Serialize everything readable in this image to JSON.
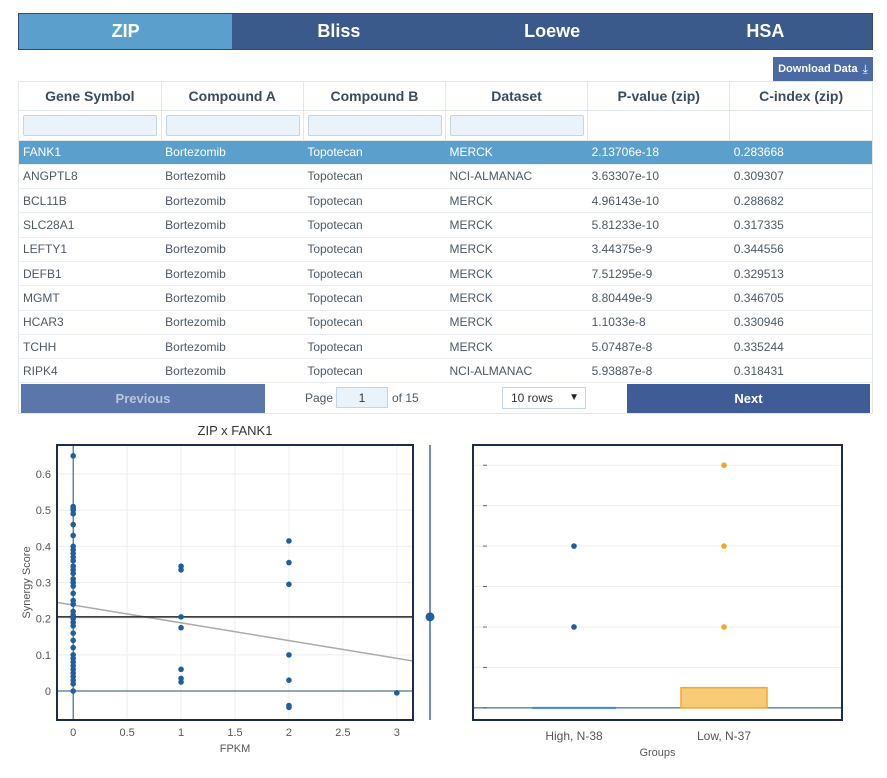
{
  "tabs": [
    {
      "label": "ZIP",
      "active": true
    },
    {
      "label": "Bliss",
      "active": false
    },
    {
      "label": "Loewe",
      "active": false
    },
    {
      "label": "HSA",
      "active": false
    }
  ],
  "download_label": "Download Data",
  "table": {
    "columns": [
      "Gene Symbol",
      "Compound A",
      "Compound B",
      "Dataset",
      "P-value (zip)",
      "C-index (zip)"
    ],
    "rows": [
      [
        "FANK1",
        "Bortezomib",
        "Topotecan",
        "MERCK",
        "2.13706e-18",
        "0.283668"
      ],
      [
        "ANGPTL8",
        "Bortezomib",
        "Topotecan",
        "NCI-ALMANAC",
        "3.63307e-10",
        "0.309307"
      ],
      [
        "BCL11B",
        "Bortezomib",
        "Topotecan",
        "MERCK",
        "4.96143e-10",
        "0.288682"
      ],
      [
        "SLC28A1",
        "Bortezomib",
        "Topotecan",
        "MERCK",
        "5.81233e-10",
        "0.317335"
      ],
      [
        "LEFTY1",
        "Bortezomib",
        "Topotecan",
        "MERCK",
        "3.44375e-9",
        "0.344556"
      ],
      [
        "DEFB1",
        "Bortezomib",
        "Topotecan",
        "MERCK",
        "7.51295e-9",
        "0.329513"
      ],
      [
        "MGMT",
        "Bortezomib",
        "Topotecan",
        "MERCK",
        "8.80449e-9",
        "0.346705"
      ],
      [
        "HCAR3",
        "Bortezomib",
        "Topotecan",
        "MERCK",
        "1.1033e-8",
        "0.330946"
      ],
      [
        "TCHH",
        "Bortezomib",
        "Topotecan",
        "MERCK",
        "5.07487e-8",
        "0.335244"
      ],
      [
        "RIPK4",
        "Bortezomib",
        "Topotecan",
        "NCI-ALMANAC",
        "5.93887e-8",
        "0.318431"
      ]
    ],
    "selected_row": 0
  },
  "pagination": {
    "prev_label": "Previous",
    "next_label": "Next",
    "page_label": "Page",
    "page_value": "1",
    "of_label": "of 15",
    "rows_option": "10 rows"
  },
  "colors": {
    "accent": "#5ba0cd",
    "tab_bar": "#3a5a8c",
    "point_blue": "#1f5fa0",
    "point_orange": "#f5a623",
    "box_fill": "#f7cb78"
  },
  "chart_data": [
    {
      "type": "scatter",
      "title": "ZIP x FANK1",
      "xlabel": "FPKM",
      "ylabel": "Synergy Score",
      "xlim": [
        -0.15,
        3.15
      ],
      "ylim": [
        -0.08,
        0.68
      ],
      "xticks": [
        0,
        0.5,
        1,
        1.5,
        2,
        2.5,
        3
      ],
      "xtick_labels": [
        "0",
        "0.5",
        "1",
        "1.5",
        "2",
        "2.5",
        "3"
      ],
      "yticks": [
        0,
        0.1,
        0.2,
        0.3,
        0.4,
        0.5,
        0.6
      ],
      "ytick_labels": [
        "0",
        "0.1",
        "0.2",
        "0.3",
        "0.4",
        "0.5",
        "0.6"
      ],
      "points": [
        [
          0,
          0.65
        ],
        [
          0,
          0.51
        ],
        [
          0,
          0.505
        ],
        [
          0,
          0.5
        ],
        [
          0,
          0.49
        ],
        [
          0,
          0.46
        ],
        [
          0,
          0.43
        ],
        [
          0,
          0.4
        ],
        [
          0,
          0.39
        ],
        [
          0,
          0.38
        ],
        [
          0,
          0.37
        ],
        [
          0,
          0.36
        ],
        [
          0,
          0.345
        ],
        [
          0,
          0.335
        ],
        [
          0,
          0.325
        ],
        [
          0,
          0.31
        ],
        [
          0,
          0.3
        ],
        [
          0,
          0.29
        ],
        [
          0,
          0.27
        ],
        [
          0,
          0.25
        ],
        [
          0,
          0.24
        ],
        [
          0,
          0.22
        ],
        [
          0,
          0.21
        ],
        [
          0,
          0.2
        ],
        [
          0,
          0.19
        ],
        [
          0,
          0.18
        ],
        [
          0,
          0.16
        ],
        [
          0,
          0.14
        ],
        [
          0,
          0.12
        ],
        [
          0,
          0.1
        ],
        [
          0,
          0.09
        ],
        [
          0,
          0.08
        ],
        [
          0,
          0.07
        ],
        [
          0,
          0.06
        ],
        [
          0,
          0.05
        ],
        [
          0,
          0.04
        ],
        [
          0,
          0.03
        ],
        [
          0,
          0.02
        ],
        [
          0,
          0.0
        ],
        [
          1,
          0.345
        ],
        [
          1,
          0.335
        ],
        [
          1,
          0.205
        ],
        [
          1,
          0.175
        ],
        [
          1,
          0.06
        ],
        [
          1,
          0.035
        ],
        [
          1,
          0.025
        ],
        [
          2,
          0.415
        ],
        [
          2,
          0.355
        ],
        [
          2,
          0.295
        ],
        [
          2,
          0.1
        ],
        [
          2,
          0.03
        ],
        [
          2,
          -0.04
        ],
        [
          2,
          -0.045
        ],
        [
          3,
          -0.005
        ]
      ],
      "trend_line": [
        [
          -0.15,
          0.245
        ],
        [
          3.15,
          0.083
        ]
      ],
      "hline": 0.205
    },
    {
      "type": "box",
      "xlabel": "Groups",
      "categories": [
        "High, N-38",
        "Low, N-37"
      ],
      "series": [
        {
          "outliers": [
            0.2,
            0.4
          ]
        },
        {
          "outliers": [
            0.2,
            0.4,
            0.6
          ],
          "box": [
            0,
            0.05
          ]
        }
      ],
      "ylim": [
        -0.03,
        0.65
      ],
      "yticks": [
        0,
        0.1,
        0.2,
        0.3,
        0.4,
        0.5,
        0.6
      ]
    }
  ]
}
